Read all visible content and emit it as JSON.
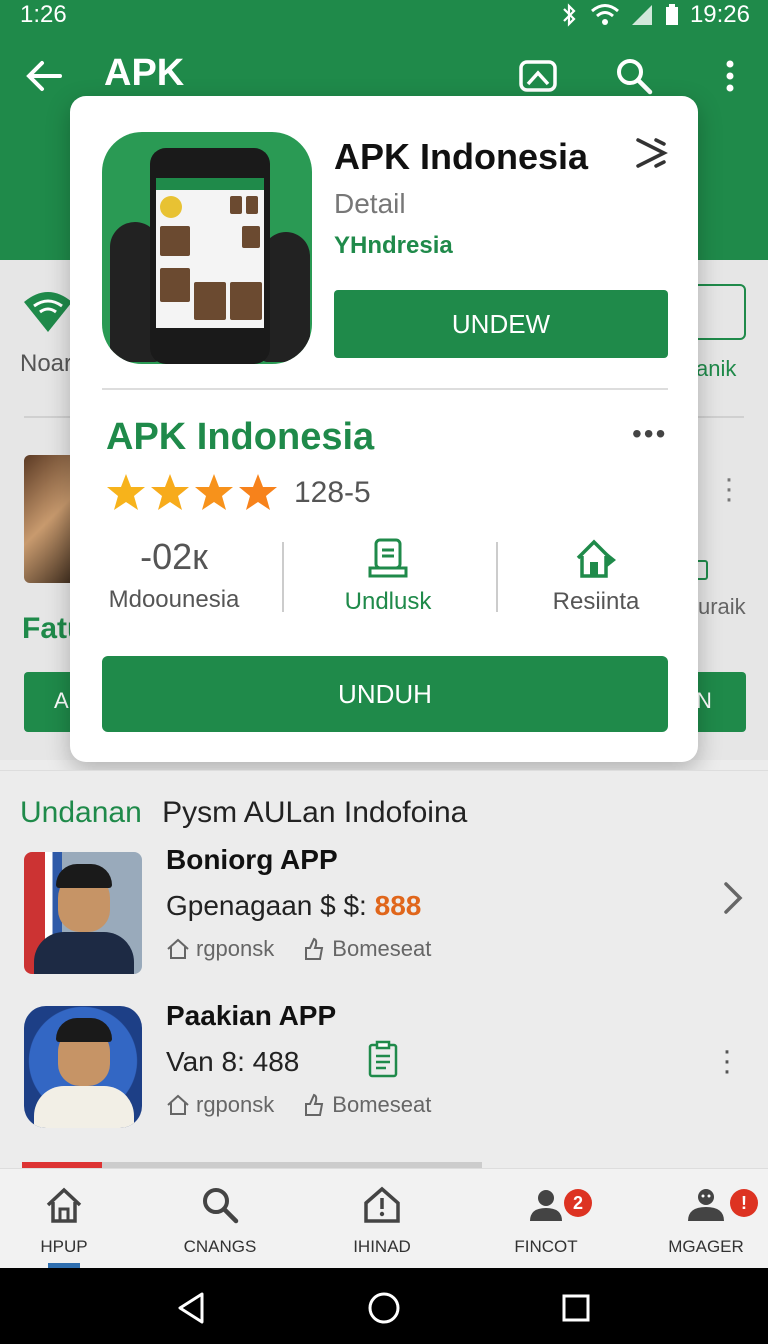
{
  "status": {
    "time": "1:26",
    "clock_right": "19:26"
  },
  "appbar": {
    "title": "APK"
  },
  "background": {
    "left_label": "Noar",
    "right_label": "anik",
    "section_label": "Fatu",
    "right_small_label": "uraik",
    "btn_left": "A",
    "btn_right": "N"
  },
  "dialog": {
    "title": "APK Indonesia",
    "subtitle": "Detail",
    "developer": "YHndresia",
    "top_button": "UNDEW",
    "app_name": "APK Indonesia",
    "more": "•••",
    "rating_text": "128-5",
    "rating_stars": 4,
    "stats": [
      {
        "value": "-02к",
        "label": "Mdoounesia"
      },
      {
        "label": "Undlusk"
      },
      {
        "label": "Resiinta"
      }
    ],
    "main_button": "UNDUH"
  },
  "list": {
    "heading_green": "Undanan",
    "heading_black": "Pysm AULan Indofoina",
    "items": [
      {
        "title": "Boniorg APP",
        "line_prefix": "Gpenagaan $ $: ",
        "price": "888",
        "meta1": "rgponsk",
        "meta2": "Bomeseat"
      },
      {
        "title": "Paakian APP",
        "line": "Van 8: 488",
        "meta1": "rgponsk",
        "meta2": "Bomeseat"
      }
    ]
  },
  "bottom_nav": [
    {
      "label": "HPUP"
    },
    {
      "label": "CNANGS"
    },
    {
      "label": "IHINAD"
    },
    {
      "label": "FINCOT",
      "badge": "2"
    },
    {
      "label": "MGAGER",
      "badge": "!"
    }
  ],
  "colors": {
    "primary": "#1f8a4a",
    "star": "#f7a21b",
    "badge": "#d32f2f",
    "price": "#e0661b"
  }
}
